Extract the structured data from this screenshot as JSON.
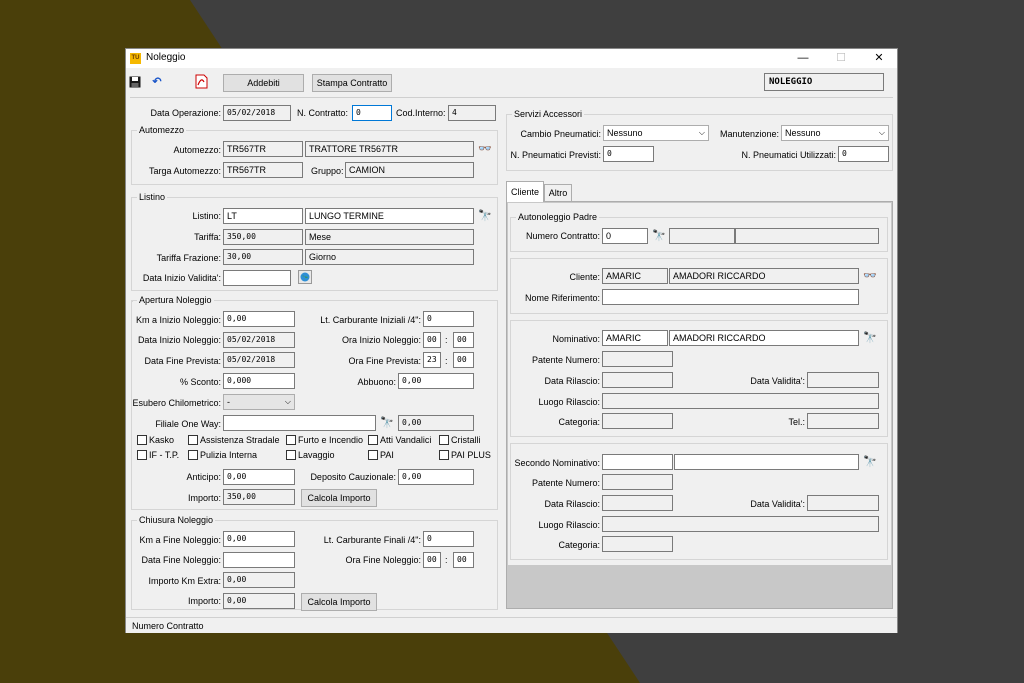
{
  "window": {
    "title": "Noleggio",
    "minimize": "—",
    "maximize": "☐",
    "close": "✕",
    "app_icon": "TU"
  },
  "toolbar": {
    "save_icon": "floppy-disk-icon",
    "undo_icon": "undo-icon",
    "pdf_icon": "pdf-icon",
    "addebiti": "Addebiti",
    "stampa_contratto": "Stampa Contratto",
    "mode": "NOLEGGIO"
  },
  "header": {
    "data_operazione_label": "Data Operazione:",
    "data_operazione": "05/02/2018",
    "n_contratto_label": "N. Contratto:",
    "n_contratto": "0",
    "cod_interno_label": "Cod.Interno:",
    "cod_interno": "4"
  },
  "automezzo": {
    "title": "Automezzo",
    "automezzo_label": "Automezzo:",
    "automezzo_code": "TR567TR",
    "automezzo_desc": "TRATTORE TR567TR",
    "targa_label": "Targa Automezzo:",
    "targa": "TR567TR",
    "gruppo_label": "Gruppo:",
    "gruppo": "CAMION"
  },
  "listino": {
    "title": "Listino",
    "listino_label": "Listino:",
    "listino_code": "LT",
    "listino_desc": "LUNGO TERMINE",
    "tariffa_label": "Tariffa:",
    "tariffa": "350,00",
    "tariffa_unit": "Mese",
    "tariffa_frazione_label": "Tariffa Frazione:",
    "tariffa_frazione": "30,00",
    "frazione_unit": "Giorno",
    "data_inizio_validita_label": "Data Inizio Validita':",
    "data_inizio_validita": ""
  },
  "apertura": {
    "title": "Apertura Noleggio",
    "km_inizio_label": "Km a Inizio Noleggio:",
    "km_inizio": "0,00",
    "lt_carb_label": "Lt. Carburante Iniziali /4\":",
    "lt_carb": "0",
    "data_inizio_label": "Data Inizio Noleggio:",
    "data_inizio": "05/02/2018",
    "ora_inizio_label": "Ora Inizio Noleggio:",
    "ora_inizio_h": "00",
    "ora_inizio_m": "00",
    "data_fine_prev_label": "Data Fine Prevista:",
    "data_fine_prev": "05/02/2018",
    "ora_fine_prev_label": "Ora Fine Prevista:",
    "ora_fine_prev_h": "23",
    "ora_fine_prev_m": "00",
    "sconto_label": "% Sconto:",
    "sconto": "0,000",
    "abbuono_label": "Abbuono:",
    "abbuono": "0,00",
    "esubero_label": "Esubero Chilometrico:",
    "esubero": "-",
    "filiale_label": "Filiale One Way:",
    "filiale": "",
    "filiale_val": "0,00",
    "checks_row1": [
      "Kasko",
      "Assistenza Stradale",
      "Furto e Incendio",
      "Atti Vandalici",
      "Cristalli"
    ],
    "checks_row2": [
      "IF - T.P.",
      "Pulizia Interna",
      "Lavaggio",
      "PAI",
      "PAI PLUS"
    ],
    "anticipo_label": "Anticipo:",
    "anticipo": "0,00",
    "deposito_label": "Deposito Cauzionale:",
    "deposito": "0,00",
    "importo_label": "Importo:",
    "importo": "350,00",
    "calcola": "Calcola Importo"
  },
  "chiusura": {
    "title": "Chiusura Noleggio",
    "km_fine_label": "Km a Fine Noleggio:",
    "km_fine": "0,00",
    "lt_carb_label": "Lt. Carburante Finali /4\":",
    "lt_carb": "0",
    "data_fine_label": "Data Fine Noleggio:",
    "data_fine": "",
    "ora_fine_label": "Ora Fine Noleggio:",
    "ora_fine_h": "00",
    "ora_fine_m": "00",
    "importo_km_label": "Importo Km Extra:",
    "importo_km": "0,00",
    "importo_label": "Importo:",
    "importo": "0,00",
    "calcola": "Calcola Importo"
  },
  "servizi": {
    "title": "Servizi Accessori",
    "cambio_label": "Cambio Pneumatici:",
    "cambio": "Nessuno",
    "manutenzione_label": "Manutenzione:",
    "manutenzione": "Nessuno",
    "pneu_previsti_label": "N. Pneumatici Previsti:",
    "pneu_previsti": "0",
    "pneu_utilizzati_label": "N. Pneumatici Utilizzati:",
    "pneu_utilizzati": "0"
  },
  "tabs": [
    {
      "label": "Cliente"
    },
    {
      "label": "Altro"
    }
  ],
  "cliente": {
    "autonoleggio_title": "Autonoleggio Padre",
    "numero_contratto_label": "Numero Contratto:",
    "numero_contratto": "0",
    "cliente_label": "Cliente:",
    "cliente_code": "AMARIC",
    "cliente_name": "AMADORI RICCARDO",
    "nome_rif_label": "Nome Riferimento:",
    "nome_rif": "",
    "nominativo_label": "Nominativo:",
    "nominativo_code": "AMARIC",
    "nominativo_name": "AMADORI RICCARDO",
    "patente_label": "Patente Numero:",
    "data_rilascio_label": "Data Rilascio:",
    "data_validita_label": "Data Validita':",
    "luogo_rilascio_label": "Luogo Rilascio:",
    "categoria_label": "Categoria:",
    "tel_label": "Tel.:",
    "secondo_label": "Secondo Nominativo:"
  },
  "status": {
    "text": "Numero Contratto"
  }
}
